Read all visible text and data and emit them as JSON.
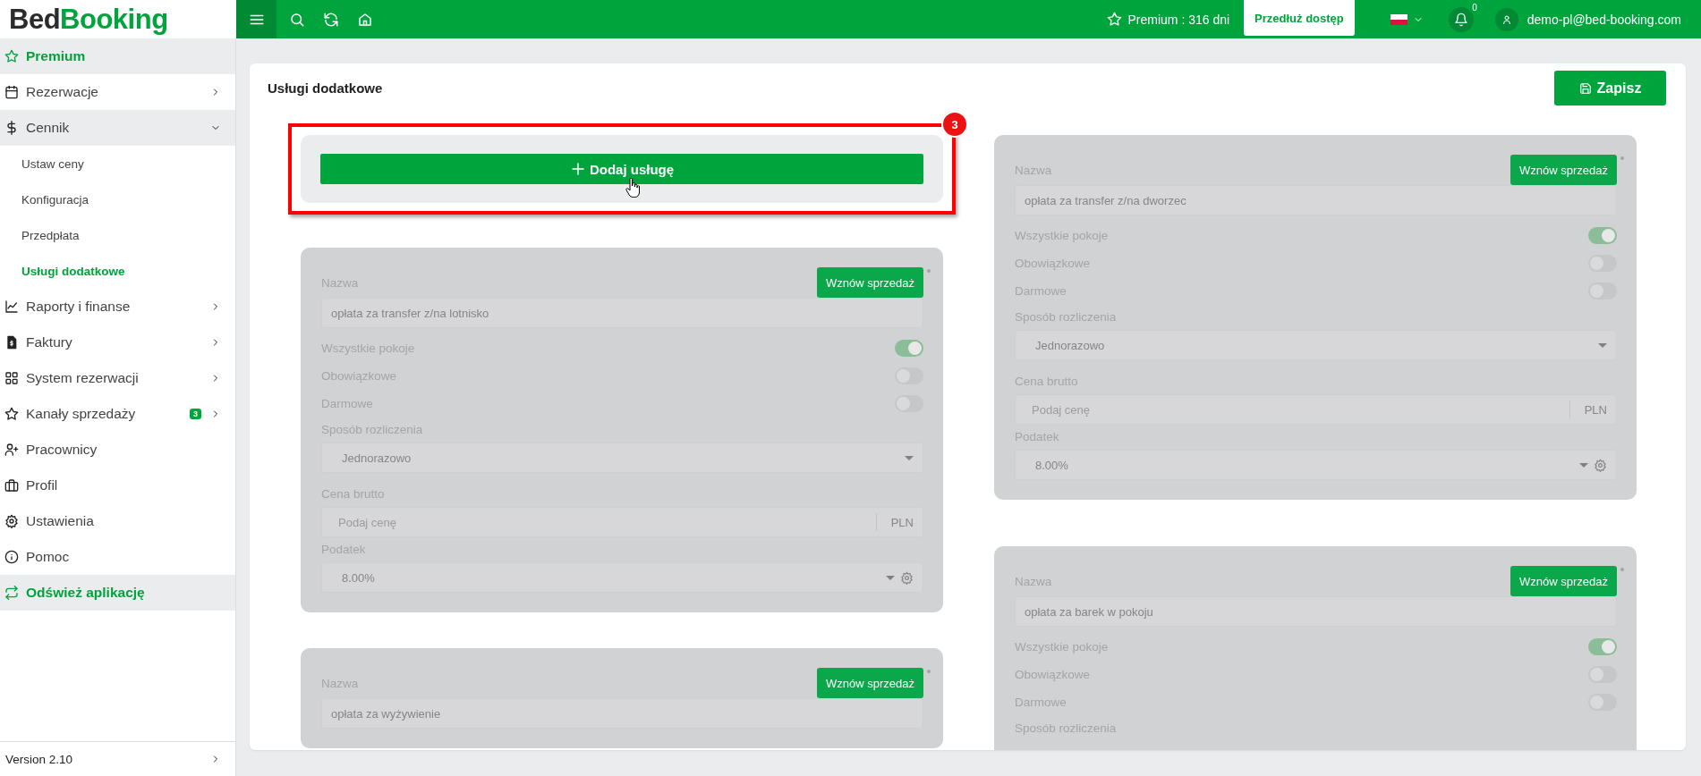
{
  "logo": {
    "first": "Bed",
    "second": "Booking"
  },
  "topbar": {
    "premium": "Premium : 316 dni",
    "extend_button": "Przedłuż dostęp",
    "notifications": "0",
    "user": "demo-pl@bed-booking.com"
  },
  "sidebar": {
    "items": [
      {
        "label": "Premium",
        "kind": "accent"
      },
      {
        "label": "Rezerwacje",
        "kind": "menu",
        "expanded": false
      },
      {
        "label": "Cennik",
        "kind": "menu",
        "expanded": true,
        "children": [
          {
            "label": "Ustaw ceny",
            "selected": false
          },
          {
            "label": "Konfiguracja",
            "selected": false
          },
          {
            "label": "Przedpłata",
            "selected": false
          },
          {
            "label": "Usługi dodatkowe",
            "selected": true
          }
        ]
      },
      {
        "label": "Raporty i finanse",
        "kind": "menu",
        "expanded": false
      },
      {
        "label": "Faktury",
        "kind": "menu",
        "expanded": false
      },
      {
        "label": "System rezerwacji",
        "kind": "menu",
        "expanded": false
      },
      {
        "label": "Kanały sprzedaży",
        "kind": "menu",
        "expanded": false,
        "badge": "3"
      },
      {
        "label": "Pracownicy",
        "kind": "link"
      },
      {
        "label": "Profil",
        "kind": "link"
      },
      {
        "label": "Ustawienia",
        "kind": "link"
      },
      {
        "label": "Pomoc",
        "kind": "link"
      },
      {
        "label": "Odśwież aplikację",
        "kind": "accent"
      }
    ],
    "version": "Version 2.10"
  },
  "page": {
    "title": "Usługi dodatkowe",
    "save_button": "Zapisz",
    "add_button": "Dodaj usługę",
    "annotation_badge": "3",
    "columns": [
      [
        {
          "name_label": "Nazwa",
          "name": "opłata za transfer z/na lotnisko",
          "resume_button": "Wznów sprzedaż",
          "toggles": [
            {
              "label": "Wszystkie pokoje",
              "on": true
            },
            {
              "label": "Obowiązkowe",
              "on": false
            },
            {
              "label": "Darmowe",
              "on": false
            }
          ],
          "billing_label": "Sposób rozliczenia",
          "billing": "Jednorazowo",
          "price_label": "Cena brutto",
          "price_placeholder": "Podaj cenę",
          "currency": "PLN",
          "tax_label": "Podatek",
          "tax": "8.00%"
        },
        {
          "name_label": "Nazwa",
          "name": "opłata za wyżywienie",
          "resume_button": "Wznów sprzedaż"
        }
      ],
      [
        {
          "name_label": "Nazwa",
          "name": "opłata za transfer z/na dworzec",
          "resume_button": "Wznów sprzedaż",
          "toggles": [
            {
              "label": "Wszystkie pokoje",
              "on": true
            },
            {
              "label": "Obowiązkowe",
              "on": false
            },
            {
              "label": "Darmowe",
              "on": false
            }
          ],
          "billing_label": "Sposób rozliczenia",
          "billing": "Jednorazowo",
          "price_label": "Cena brutto",
          "price_placeholder": "Podaj cenę",
          "currency": "PLN",
          "tax_label": "Podatek",
          "tax": "8.00%"
        },
        {
          "name_label": "Nazwa",
          "name": "opłata za barek w pokoju",
          "resume_button": "Wznów sprzedaż",
          "toggles": [
            {
              "label": "Wszystkie pokoje",
              "on": true
            },
            {
              "label": "Obowiązkowe",
              "on": false
            },
            {
              "label": "Darmowe",
              "on": false
            }
          ],
          "billing_label": "Sposób rozliczenia"
        }
      ]
    ]
  }
}
